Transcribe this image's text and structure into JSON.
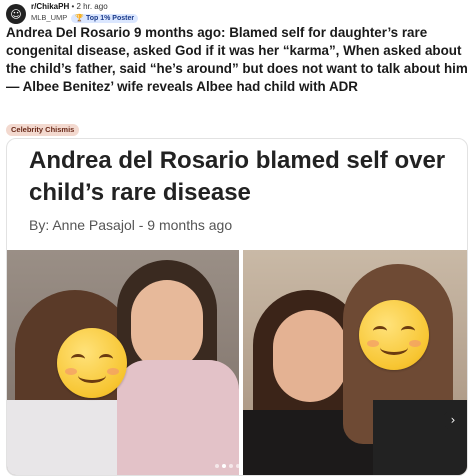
{
  "post": {
    "subreddit": "r/ChikaPH",
    "age": "2 hr. ago",
    "username": "MLB_UMP",
    "badge": "Top 1% Poster",
    "title": "Andrea Del Rosario 9 months ago: Blamed self for daughter’s rare congenital disease, asked God if it was her “karma”, When asked about the child’s father, said “he’s around” but does not want to talk about him — Albee Benitez’ wife reveals Albee had child with ADR",
    "flair": "Celebrity Chismis"
  },
  "article": {
    "headline": "Andrea del Rosario blamed self over child’s rare disease",
    "byline": "By: Anne Pasajol - 9 months ago"
  },
  "carousel": {
    "next_glyph": "›",
    "dot_count": 4,
    "active_dot": 1
  },
  "icons": {
    "subreddit": "subreddit-icon",
    "badge": "trophy-icon",
    "next": "chevron-right-icon",
    "emoji": "smiling-face-emoji-icon"
  },
  "colors": {
    "flair_bg": "#f3d9cf",
    "badge_bg": "#dbe7ff",
    "emoji": "#f7c531"
  }
}
